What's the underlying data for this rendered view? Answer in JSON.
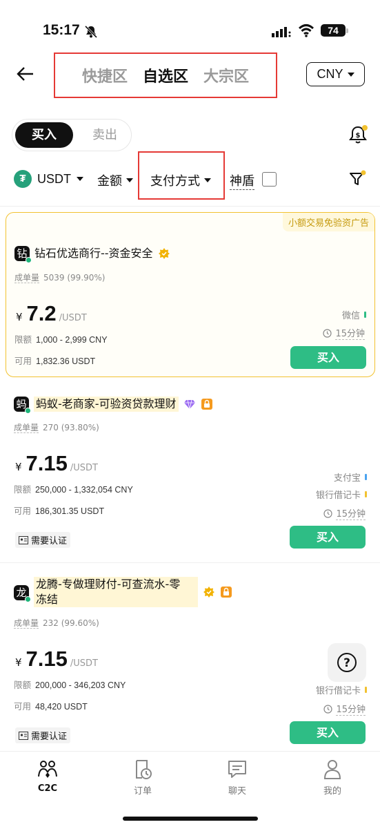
{
  "status_bar": {
    "time": "15:17",
    "battery": "74"
  },
  "header": {
    "zone_tabs": [
      "快捷区",
      "自选区",
      "大宗区"
    ],
    "active_zone": "自选区",
    "currency": "CNY"
  },
  "trade_toggle": {
    "buy": "买入",
    "sell": "卖出",
    "active": "买入"
  },
  "filters": {
    "coin": "USDT",
    "amount": "金额",
    "payment": "支付方式",
    "shield": "神盾"
  },
  "listings": [
    {
      "promo": "小额交易免验资广告",
      "avatar": "钻",
      "merchant": "钻石优选商行--资金安全",
      "orders_label": "成单量",
      "orders": "5039 (99.90%)",
      "currency_symbol": "¥",
      "price": "7.2",
      "price_unit": "/USDT",
      "limit_label": "限额",
      "limit": "1,000 - 2,999 CNY",
      "available_label": "可用",
      "available": "1,832.36 USDT",
      "payments": [
        {
          "name": "微信",
          "color": "#2ebd85"
        }
      ],
      "time_limit": "15分钟",
      "buy_label": "买入"
    },
    {
      "avatar": "蚂",
      "merchant": "蚂蚁-老商家-可验资贷款理财",
      "orders_label": "成单量",
      "orders": "270 (93.80%)",
      "currency_symbol": "¥",
      "price": "7.15",
      "price_unit": "/USDT",
      "limit_label": "限额",
      "limit": "250,000 - 1,332,054 CNY",
      "available_label": "可用",
      "available": "186,301.35 USDT",
      "payments": [
        {
          "name": "支付宝",
          "color": "#4aa3f0"
        },
        {
          "name": "银行借记卡",
          "color": "#f2c230"
        }
      ],
      "time_limit": "15分钟",
      "kyc": "需要认证",
      "buy_label": "买入"
    },
    {
      "avatar": "龙",
      "merchant_line1": "龙腾-专做理财付-可查流水-零",
      "merchant_line2": "冻结",
      "orders_label": "成单量",
      "orders": "232 (99.60%)",
      "currency_symbol": "¥",
      "price": "7.15",
      "price_unit": "/USDT",
      "limit_label": "限额",
      "limit": "200,000 - 346,203 CNY",
      "available_label": "可用",
      "available": "48,420 USDT",
      "payments": [
        {
          "name": "银行借记卡",
          "color": "#f2c230"
        }
      ],
      "time_limit": "15分钟",
      "kyc": "需要认证",
      "buy_label": "买入"
    }
  ],
  "bottom_nav": [
    {
      "label": "C2C",
      "icon": "people-icon"
    },
    {
      "label": "订单",
      "icon": "order-icon"
    },
    {
      "label": "聊天",
      "icon": "chat-icon"
    },
    {
      "label": "我的",
      "icon": "profile-icon"
    }
  ],
  "colors": {
    "accent_green": "#2ebd85",
    "highlight_red": "#e53935",
    "featured_border": "#f2c230"
  }
}
